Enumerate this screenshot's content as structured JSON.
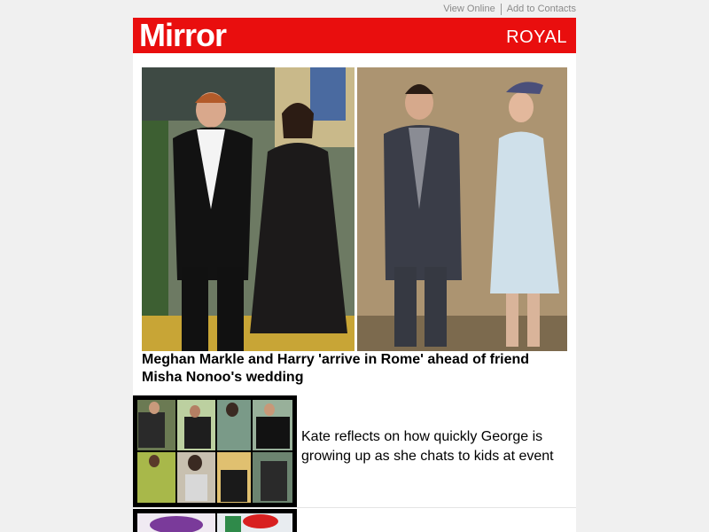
{
  "topbar": {
    "view_online": "View Online",
    "add_contacts": "Add to Contacts"
  },
  "header": {
    "logo": "Mirror",
    "section": "ROYAL",
    "brand_color": "#e90e0e"
  },
  "lead_story": {
    "headline": "Meghan Markle and Harry 'arrive in Rome' ahead of friend Misha Nonoo's wedding"
  },
  "stories": [
    {
      "text": "Kate reflects on how quickly George is growing up as she chats to kids at event"
    }
  ]
}
